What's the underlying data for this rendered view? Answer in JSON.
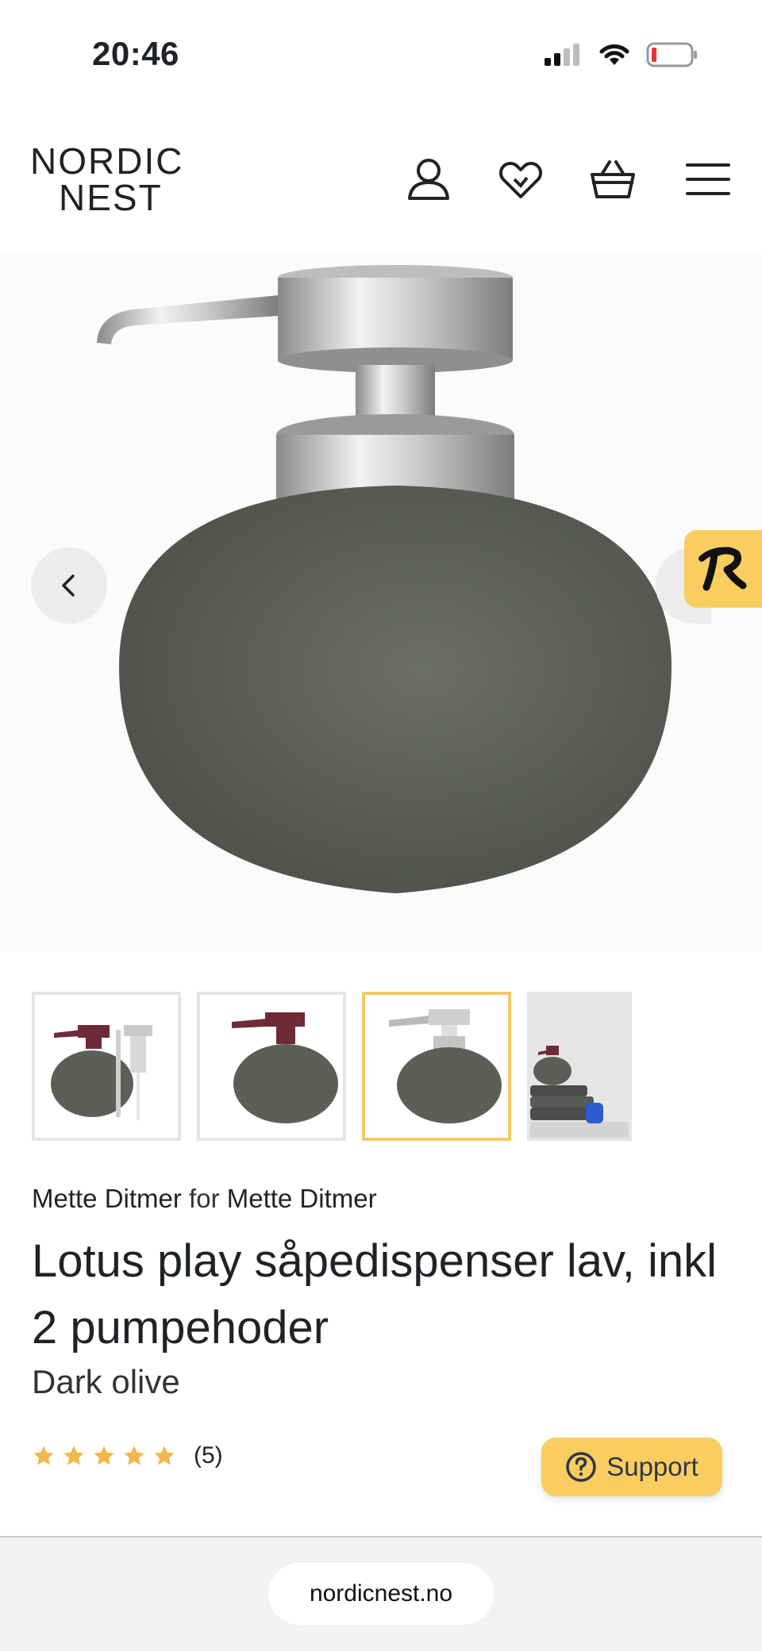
{
  "status_bar": {
    "time": "20:46"
  },
  "header": {
    "logo_line1": "NORDIC",
    "logo_line2": "NEST",
    "icons": [
      "user-icon",
      "heart-icon",
      "cart-icon",
      "menu-icon"
    ]
  },
  "gallery": {
    "prev_icon": "chevron-left-icon",
    "thumbnails": [
      {
        "name": "thumb-dispenser-two-pumps",
        "active": false
      },
      {
        "name": "thumb-dispenser-burgundy-pump",
        "active": false
      },
      {
        "name": "thumb-dispenser-steel-pump",
        "active": true
      },
      {
        "name": "thumb-bathroom-scene",
        "active": false
      }
    ]
  },
  "product": {
    "brand": "Mette Ditmer",
    "for_word": "for",
    "designer": "Mette Ditmer",
    "title": "Lotus play såpedispenser lav, inkl 2 pumpehoder",
    "variant": "Dark olive",
    "rating": 5,
    "review_count": "(5)"
  },
  "support": {
    "label": "Support"
  },
  "browser": {
    "url": "nordicnest.no"
  },
  "colors": {
    "accent": "#f9cd60",
    "dispenser_body": "#5b5e59",
    "star": "#f2b84b"
  }
}
